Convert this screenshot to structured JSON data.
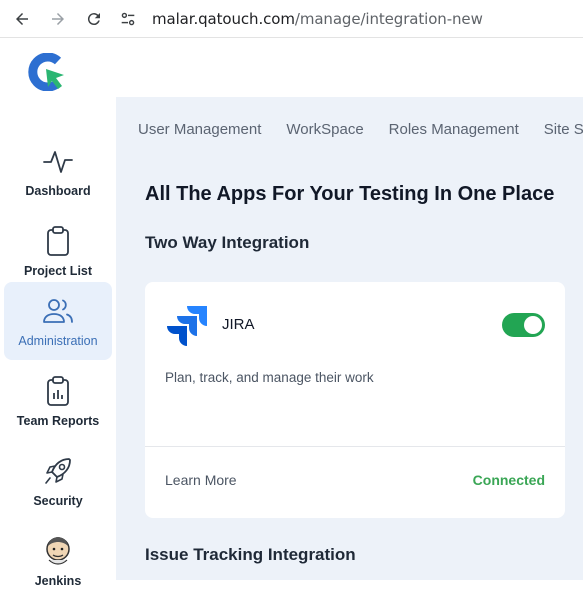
{
  "browser": {
    "url_host": "malar.qatouch.com",
    "url_path": "/manage/integration-new",
    "icons": [
      "back-arrow-icon",
      "forward-arrow-icon",
      "reload-icon",
      "site-settings-icon"
    ]
  },
  "sidebar": {
    "items": [
      {
        "label": "Dashboard",
        "icon": "pulse-icon"
      },
      {
        "label": "Project List",
        "icon": "clipboard-icon"
      },
      {
        "label": "Administration",
        "icon": "users-icon"
      },
      {
        "label": "Team Reports",
        "icon": "report-clipboard-icon"
      },
      {
        "label": "Security",
        "icon": "rocket-icon"
      },
      {
        "label": "Jenkins",
        "icon": "jenkins-icon"
      }
    ]
  },
  "tabs": [
    "User Management",
    "WorkSpace",
    "Roles Management",
    "Site S"
  ],
  "main": {
    "heading": "All The Apps For Your Testing In One Place",
    "section_two_way": "Two Way Integration",
    "section_issue": "Issue Tracking Integration"
  },
  "card": {
    "name": "JIRA",
    "description": "Plan, track, and manage their work",
    "learn_more": "Learn More",
    "status": "Connected",
    "toggle_on": true
  },
  "colors": {
    "accent_blue": "#3b6fb6",
    "toggle_green": "#22a553",
    "connected_green": "#3aa655",
    "main_bg": "#edf2f9"
  }
}
